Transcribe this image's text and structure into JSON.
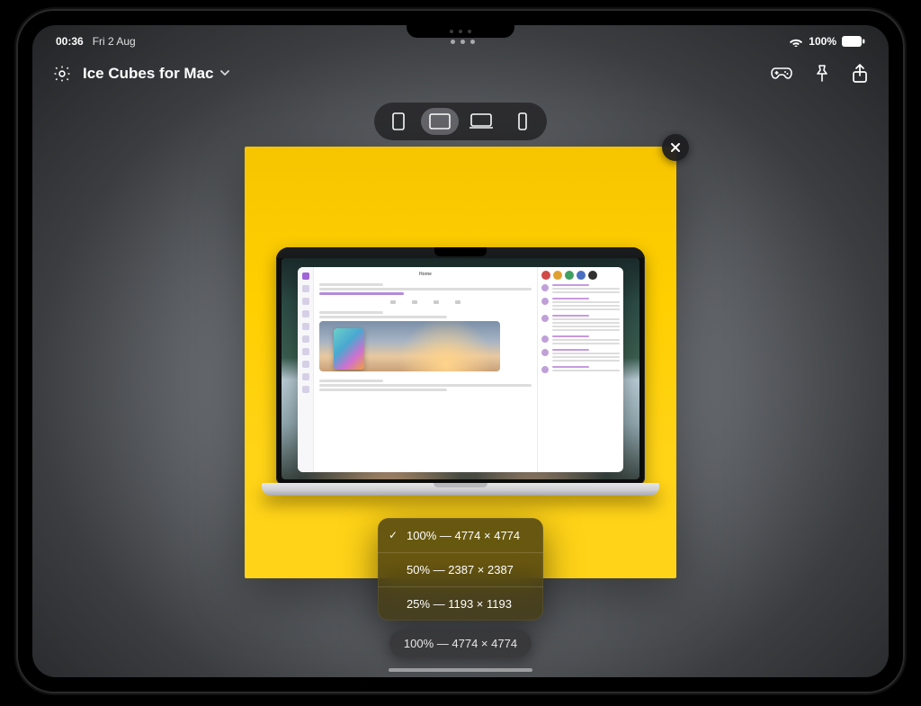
{
  "status": {
    "time": "00:36",
    "date": "Fri 2 Aug",
    "battery_pct": "100%"
  },
  "nav": {
    "title": "Ice Cubes for Mac"
  },
  "device_picker": {
    "options": [
      "ipad-portrait",
      "ipad-landscape",
      "mac",
      "iphone"
    ],
    "selected_index": 1
  },
  "size_menu": {
    "options": [
      {
        "label": "100% — 4774 × 4774",
        "selected": true
      },
      {
        "label": "50% — 2387 × 2387",
        "selected": false
      },
      {
        "label": "25% — 1193 × 1193",
        "selected": false
      }
    ]
  },
  "size_pill": "100% — 4774 × 4774",
  "mockup": {
    "app_header": "Home"
  }
}
